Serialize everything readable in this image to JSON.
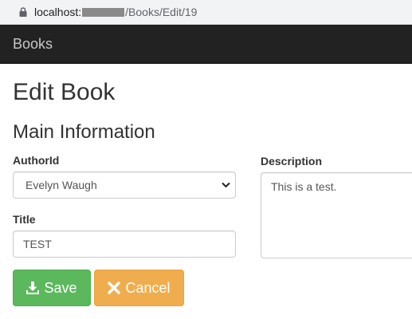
{
  "browser": {
    "url_host": "localhost:",
    "url_path": "/Books/Edit/19"
  },
  "navbar": {
    "brand": "Books"
  },
  "page": {
    "title": "Edit Book",
    "section_title": "Main Information"
  },
  "form": {
    "author": {
      "label": "AuthorId",
      "selected": "Evelyn Waugh"
    },
    "title": {
      "label": "Title",
      "value": "TEST"
    },
    "description": {
      "label": "Description",
      "value": "This is a test."
    }
  },
  "actions": {
    "save_label": "Save",
    "cancel_label": "Cancel"
  },
  "colors": {
    "navbar": "#222222",
    "save": "#5cb85c",
    "cancel": "#f0ad4e",
    "text": "#333333"
  },
  "icons": {
    "lock": "lock-icon",
    "select": "chevron-down-icon",
    "save": "download-icon",
    "cancel": "close-icon"
  }
}
